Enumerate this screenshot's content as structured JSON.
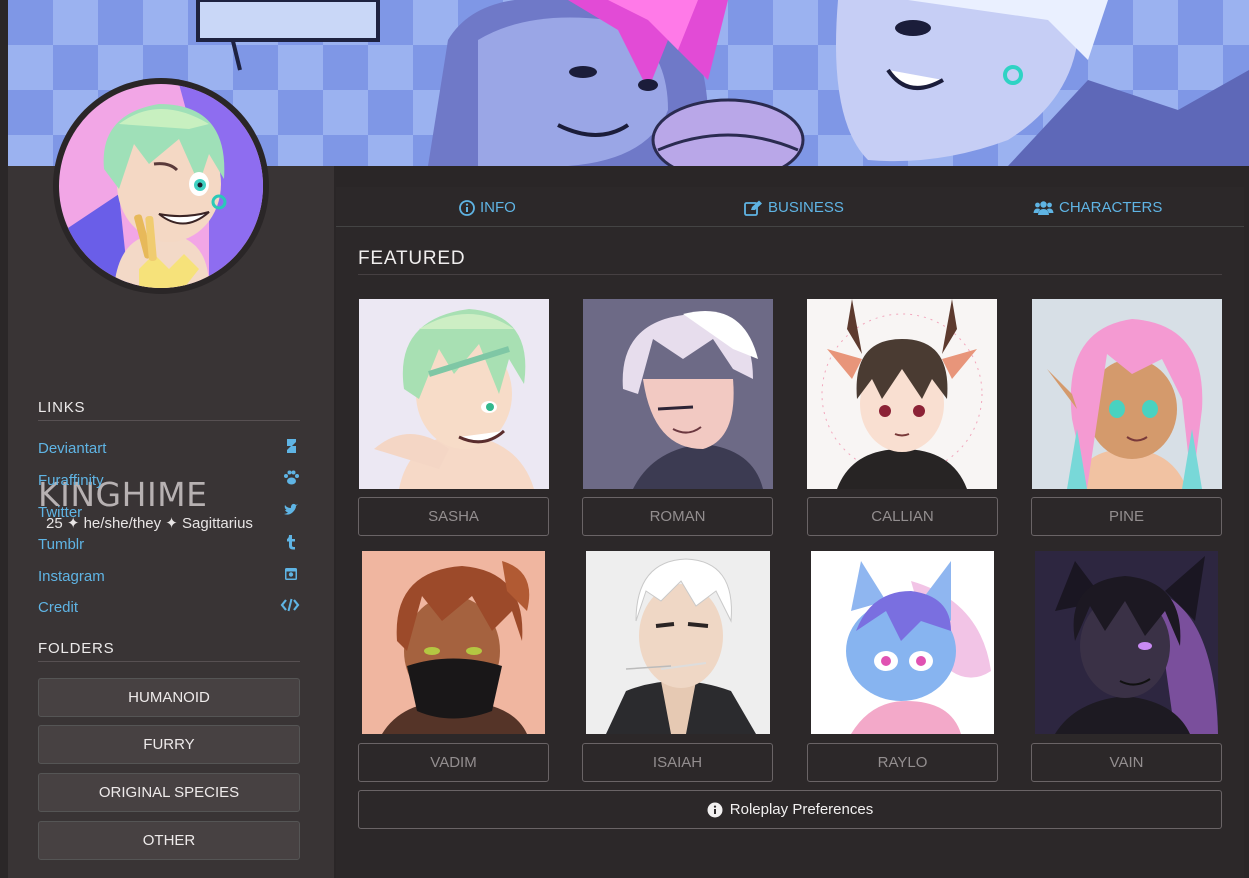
{
  "profile": {
    "username": "KINGHIME",
    "subinfo": "25 ✦ he/she/they ✦ Sagittarius"
  },
  "links": {
    "heading": "LINKS",
    "items": [
      {
        "label": "Deviantart",
        "icon": "deviantart-icon"
      },
      {
        "label": "Furaffinity",
        "icon": "paw-icon"
      },
      {
        "label": "Twitter",
        "icon": "twitter-icon"
      },
      {
        "label": "Tumblr",
        "icon": "tumblr-icon"
      },
      {
        "label": "Instagram",
        "icon": "instagram-icon"
      },
      {
        "label": "Credit",
        "icon": "code-icon"
      }
    ]
  },
  "folders": {
    "heading": "FOLDERS",
    "items": [
      "HUMANOID",
      "FURRY",
      "ORIGINAL SPECIES",
      "OTHER"
    ]
  },
  "tabs": [
    {
      "label": "INFO",
      "icon": "info-circle-icon"
    },
    {
      "label": "BUSINESS",
      "icon": "edit-icon"
    },
    {
      "label": "CHARACTERS",
      "icon": "users-icon"
    }
  ],
  "featured": {
    "heading": "FEATURED",
    "characters": [
      "SASHA",
      "ROMAN",
      "CALLIAN",
      "PINE",
      "VADIM",
      "ISAIAH",
      "RAYLO",
      "VAIN"
    ]
  },
  "roleplay_button": {
    "label": "Roleplay Preferences",
    "icon": "info-circle-icon"
  },
  "colors": {
    "accent": "#5fb4e4",
    "sidebar": "#393435",
    "background": "#2a2627"
  }
}
